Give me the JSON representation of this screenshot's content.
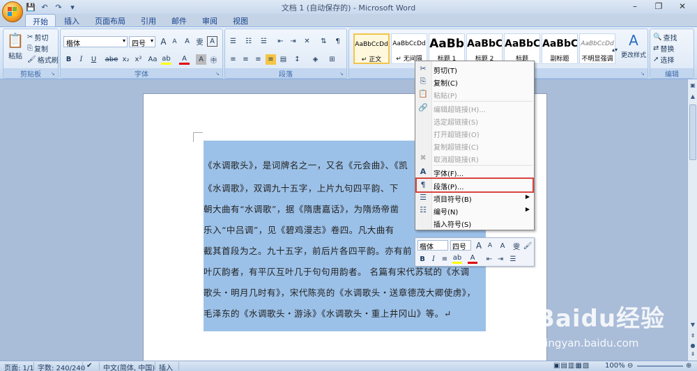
{
  "window": {
    "title": "文档 1 (自动保存的) - Microsoft Word",
    "minimize": "–",
    "restore": "❐",
    "close": "✕"
  },
  "qat": {
    "save": "💾",
    "undo": "↶",
    "redo": "↷",
    "customize": "▾"
  },
  "tabs": [
    "开始",
    "插入",
    "页面布局",
    "引用",
    "邮件",
    "审阅",
    "视图"
  ],
  "ribbon": {
    "clipboard": {
      "label": "剪贴板",
      "paste": "粘贴",
      "cut": "剪切",
      "copy": "复制",
      "format_painter": "格式刷"
    },
    "font": {
      "label": "字体",
      "font_name": "楷体",
      "font_size": "四号",
      "bold": "B",
      "italic": "I",
      "underline": "U",
      "strike": "abe",
      "subscript": "x₂",
      "superscript": "x²",
      "change_case": "Aa",
      "grow": "A",
      "shrink": "A",
      "clear": "A",
      "phonetic": "雯",
      "border": "A",
      "highlight": "ab",
      "font_color": "A",
      "shading": "A",
      "encircle": "㊥"
    },
    "paragraph": {
      "label": "段落"
    },
    "styles": {
      "label": "样式",
      "items": [
        {
          "sample": "AaBbCcDd",
          "name": "↵ 正文"
        },
        {
          "sample": "AaBbCcDd",
          "name": "↵ 无间隔"
        },
        {
          "sample": "AaBb",
          "name": "标题 1"
        },
        {
          "sample": "AaBbC",
          "name": "标题 2"
        },
        {
          "sample": "AaBbC",
          "name": "标题"
        },
        {
          "sample": "AaBbC",
          "name": "副标题"
        },
        {
          "sample": "AaBbCcDd",
          "name": "不明显强调"
        }
      ],
      "change_styles": "更改样式"
    },
    "editing": {
      "label": "编辑",
      "find": "查找",
      "replace": "替换",
      "select": "选择"
    }
  },
  "document": {
    "lines": [
      "《水调歌头》，是词牌名之一，又名《元会曲》、《凯",
      "《水调歌》，双调九十五字，上片九句四平韵、下",
      "朝大曲有“水调歌”，据《隋唐嘉话》，为隋炀帝凿",
      "乐入“中吕调”，见《碧鸡漫志》卷四。凡大曲有",
      "截其首段为之。九十五字，前后片各四平韵。亦有前",
      "叶仄韵者，有平仄互叶几于句句用韵者。 名篇有宋代苏轼的《水调",
      "歌头・明月几时有》，宋代陈亮的《水调歌头・送章德茂大卿使虏》，",
      "毛泽东的《水调歌头・游泳》《水调歌头・重上井冈山》等。↵"
    ]
  },
  "context_menu": {
    "items": [
      {
        "icon": "✂",
        "label": "剪切(T)",
        "enabled": true
      },
      {
        "icon": "⎘",
        "label": "复制(C)",
        "enabled": true
      },
      {
        "icon": "📋",
        "label": "粘贴(P)",
        "enabled": false
      },
      {
        "icon": "🔗",
        "label": "编辑超链接(H)...",
        "enabled": false
      },
      {
        "icon": "",
        "label": "选定超链接(S)",
        "enabled": false
      },
      {
        "icon": "",
        "label": "打开超链接(O)",
        "enabled": false
      },
      {
        "icon": "",
        "label": "复制超链接(C)",
        "enabled": false
      },
      {
        "icon": "✖",
        "label": "取消超链接(R)",
        "enabled": false
      },
      {
        "icon": "A",
        "label": "字体(F)...",
        "enabled": true
      },
      {
        "icon": "¶",
        "label": "段落(P)...",
        "enabled": true,
        "highlighted": true
      },
      {
        "icon": "☰",
        "label": "项目符号(B)",
        "enabled": true,
        "submenu": true
      },
      {
        "icon": "☷",
        "label": "编号(N)",
        "enabled": true,
        "submenu": true
      },
      {
        "icon": "",
        "label": "插入符号(S)",
        "enabled": true
      }
    ]
  },
  "mini_toolbar": {
    "font_name": "楷体",
    "font_size": "四号",
    "grow": "A",
    "shrink": "A",
    "style": "A",
    "phonetic": "雯",
    "painter": "🖌",
    "bold": "B",
    "italic": "I",
    "center": "≡",
    "highlight": "ab",
    "font_color": "A",
    "decrease_indent": "⇤",
    "increase_indent": "⇥",
    "bullets": "☰"
  },
  "status": {
    "page": "页面: 1/1",
    "words": "字数: 240/240",
    "language": "中文(简体, 中国)",
    "mode": "插入",
    "zoom": "100%"
  },
  "watermark": {
    "brand": "Baidu经验",
    "url": "jingyan.baidu.com"
  },
  "colors": {
    "highlight_box": "#d9433f",
    "selection": "#9cc1e8",
    "accent": "#15428b"
  }
}
